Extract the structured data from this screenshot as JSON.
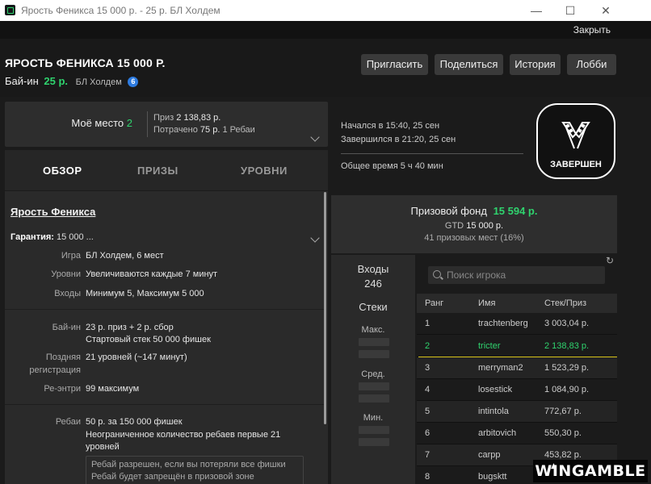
{
  "window": {
    "title": "Ярость Феникса 15 000 р. - 25 р. БЛ Холдем",
    "close_link": "Закрыть"
  },
  "header": {
    "title": "ЯРОСТЬ ФЕНИКСА 15 000 Р.",
    "buyin_label": "Бай-ин",
    "buyin_amount": "25 р.",
    "game": "БЛ Холдем",
    "info_count": "6",
    "buttons": {
      "invite": "Пригласить",
      "share": "Поделиться",
      "history": "История",
      "lobby": "Лобби"
    }
  },
  "my_seat": {
    "label": "Моё место",
    "place": "2",
    "prize_label": "Приз",
    "prize_value": "2 138,83 р.",
    "spent_label": "Потрачено",
    "spent_value": "75 р.",
    "rebuys": "1 Ребаи"
  },
  "tabs": [
    "ОБЗОР",
    "ПРИЗЫ",
    "УРОВНИ"
  ],
  "overview": {
    "name": "Ярость Феникса",
    "guarantee_label": "Гарантия:",
    "guarantee_value": "15 000 ...",
    "rows": [
      {
        "label": "Игра",
        "value": "БЛ Холдем, 6 мест"
      },
      {
        "label": "Уровни",
        "value": "Увеличиваются каждые 7 минут"
      },
      {
        "label": "Входы",
        "value": "Минимум 5, Максимум 5 000"
      },
      {
        "label": "Бай-ин",
        "value": "23 р. приз + 2 р. сбор",
        "value2": "Стартовый стек 50 000 фишек"
      },
      {
        "label": "Поздняя",
        "label2": "регистрация",
        "value": "21 уровней (~147 минут)"
      },
      {
        "label": "Ре-энтри",
        "value": "99 максимум"
      },
      {
        "label": "Ребаи",
        "value": "50 р. за 150 000 фишек",
        "value2": "Неограниченное количество ребаев первые 21",
        "value3": "уровней"
      }
    ],
    "note_line1": "Ребай разрешен, если вы потеряли все фишки",
    "note_line2": "Ребай будет запрещён в призовой зоне"
  },
  "status": {
    "started": "Начался в 15:40, 25 сен",
    "finished": "Завершился в 21:20, 25 сен",
    "total_time": "Общее время 5 ч 40 мин",
    "badge": "ЗАВЕРШЕН"
  },
  "prize_pool": {
    "label": "Призовой фонд",
    "value": "15 594 р.",
    "gtd_label": "GTD",
    "gtd_value": "15 000 р.",
    "paid_places": "41 призовых мест (16%)"
  },
  "stats": {
    "entries_label": "Входы",
    "entries_value": "246",
    "stacks_label": "Стеки",
    "max_label": "Макс.",
    "avg_label": "Сред.",
    "min_label": "Мин."
  },
  "players": {
    "search_placeholder": "Поиск игрока",
    "columns": [
      "Ранг",
      "Имя",
      "Стек/Приз"
    ],
    "rows": [
      {
        "rank": "1",
        "name": "trachtenberg",
        "prize": "3 003,04 р."
      },
      {
        "rank": "2",
        "name": "tricter",
        "prize": "2 138,83 р."
      },
      {
        "rank": "3",
        "name": "merryman2",
        "prize": "1 523,29 р."
      },
      {
        "rank": "4",
        "name": "losestick",
        "prize": "1 084,90 р."
      },
      {
        "rank": "5",
        "name": "intintola",
        "prize": "772,67 р."
      },
      {
        "rank": "6",
        "name": "arbitovich",
        "prize": "550,30 р."
      },
      {
        "rank": "7",
        "name": "carpp",
        "prize": "453,82 р."
      },
      {
        "rank": "8",
        "name": "bugsktt",
        "prize": ""
      }
    ]
  },
  "watermark": "WINGAMBLE",
  "colors": {
    "accent_green": "#2fd36e",
    "highlight_yellow": "#d8c419",
    "info_blue": "#2d7be0"
  }
}
